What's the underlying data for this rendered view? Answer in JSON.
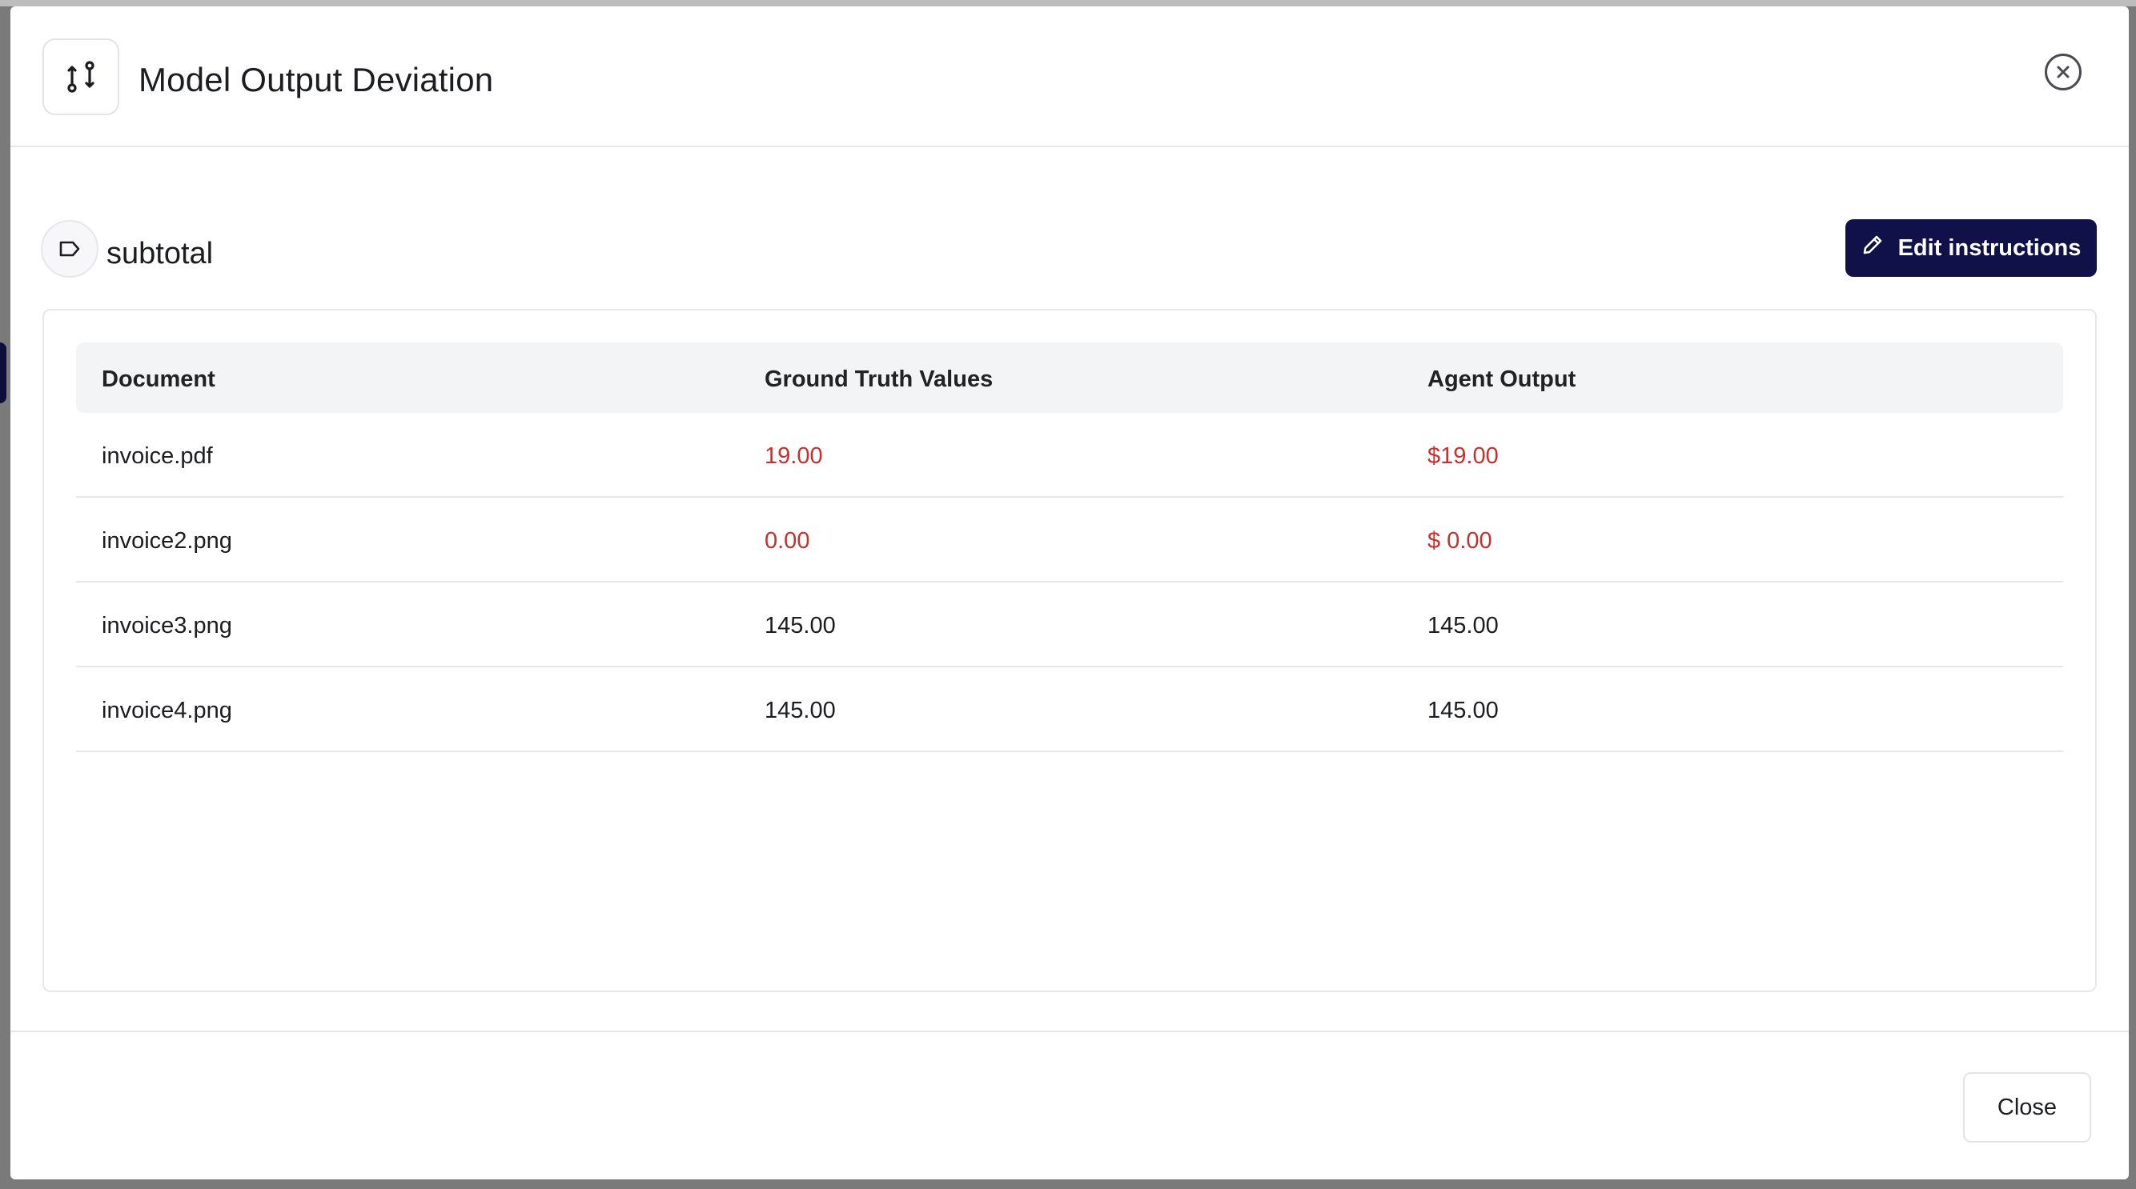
{
  "modal": {
    "title": "Model Output Deviation",
    "title_icon": "git-compare-icon",
    "close_icon": "close-circle-icon"
  },
  "field": {
    "icon": "tag-icon",
    "name": "subtotal",
    "edit_button_label": "Edit instructions",
    "edit_button_icon": "pencil-icon"
  },
  "table": {
    "headers": [
      "Document",
      "Ground Truth Values",
      "Agent Output"
    ],
    "rows": [
      {
        "document": "invoice.pdf",
        "ground_truth": "19.00",
        "agent_output": "$19.00",
        "mismatch": true
      },
      {
        "document": "invoice2.png",
        "ground_truth": "0.00",
        "agent_output": "$ 0.00",
        "mismatch": true
      },
      {
        "document": "invoice3.png",
        "ground_truth": "145.00",
        "agent_output": "145.00",
        "mismatch": false
      },
      {
        "document": "invoice4.png",
        "ground_truth": "145.00",
        "agent_output": "145.00",
        "mismatch": false
      }
    ]
  },
  "footer": {
    "close_label": "Close"
  },
  "colors": {
    "primary": "#11114a",
    "mismatch": "#c9302c"
  }
}
